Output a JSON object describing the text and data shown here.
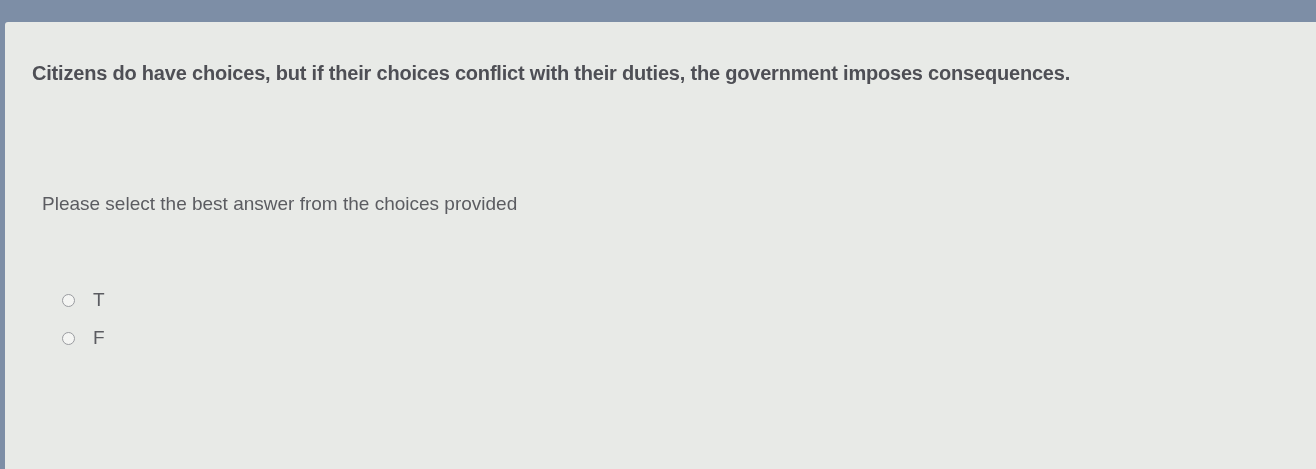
{
  "question": "Citizens do have choices, but if their choices conflict with their duties, the government imposes consequences.",
  "prompt": "Please select the best answer from the choices provided",
  "choices": [
    {
      "label": "T",
      "selected": false
    },
    {
      "label": "F",
      "selected": false
    }
  ]
}
